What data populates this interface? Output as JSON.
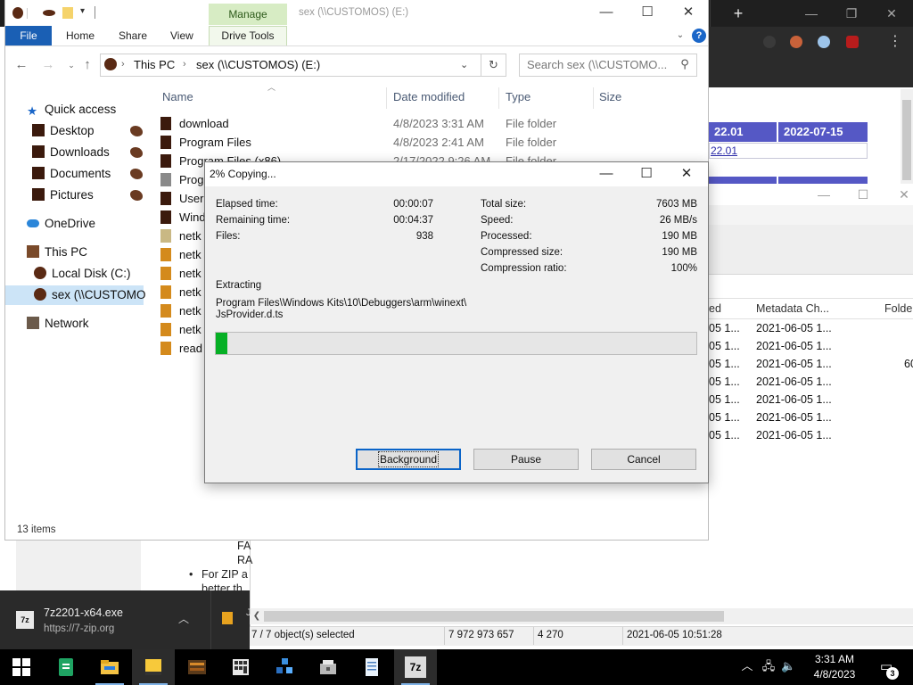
{
  "explorer": {
    "title": "sex (\\\\CUSTOMOS) (E:)",
    "manage_tab": "Manage",
    "ribbon": {
      "file": "File",
      "home": "Home",
      "share": "Share",
      "view": "View",
      "drive_tools": "Drive Tools"
    },
    "address": {
      "part1": "This PC",
      "part2": "sex (\\\\CUSTOMOS) (E:)"
    },
    "search_placeholder": "Search sex (\\\\CUSTOMO...",
    "nav": {
      "quick_access": "Quick access",
      "desktop": "Desktop",
      "downloads": "Downloads",
      "documents": "Documents",
      "pictures": "Pictures",
      "onedrive": "OneDrive",
      "this_pc": "This PC",
      "local_disk": "Local Disk (C:)",
      "sex_drive": "sex (\\\\CUSTOMO",
      "network": "Network"
    },
    "columns": {
      "name": "Name",
      "date": "Date modified",
      "type": "Type",
      "size": "Size"
    },
    "files": [
      {
        "name": "download",
        "date": "4/8/2023 3:31 AM",
        "type": "File folder"
      },
      {
        "name": "Program Files",
        "date": "4/8/2023 2:41 AM",
        "type": "File folder"
      },
      {
        "name": "Program Files (x86)",
        "date": "2/17/2022 9:26 AM",
        "type": "File folder"
      },
      {
        "name": "Prog"
      },
      {
        "name": "User"
      },
      {
        "name": "Wind"
      },
      {
        "name": "netk"
      },
      {
        "name": "netk"
      },
      {
        "name": "netk"
      },
      {
        "name": "netk"
      },
      {
        "name": "netk"
      },
      {
        "name": "netk"
      },
      {
        "name": "read"
      }
    ],
    "status": "13 items"
  },
  "dialog": {
    "title": "2% Copying...",
    "elapsed_label": "Elapsed time:",
    "elapsed_value": "00:00:07",
    "remaining_label": "Remaining time:",
    "remaining_value": "00:04:37",
    "files_label": "Files:",
    "files_value": "938",
    "total_label": "Total size:",
    "total_value": "7603 MB",
    "speed_label": "Speed:",
    "speed_value": "26 MB/s",
    "processed_label": "Processed:",
    "processed_value": "190 MB",
    "compressed_label": "Compressed size:",
    "compressed_value": "190 MB",
    "ratio_label": "Compression ratio:",
    "ratio_value": "100%",
    "operation": "Extracting",
    "path_line1": "Program Files\\Windows Kits\\10\\Debuggers\\arm\\winext\\",
    "path_line2": "JsProvider.d.ts",
    "progress": 0.025,
    "progress_color": "#06b025",
    "buttons": {
      "background": "Background",
      "pause": "Pause",
      "cancel": "Cancel"
    }
  },
  "sevenzip": {
    "columns": {
      "modified": "ed",
      "metadata": "Metadata Ch...",
      "folders": "Folde"
    },
    "rows": [
      {
        "modified": "05 1...",
        "metadata": "2021-06-05 1...",
        "folders": ""
      },
      {
        "modified": "05 1...",
        "metadata": "2021-06-05 1...",
        "folders": ""
      },
      {
        "modified": "05 1...",
        "metadata": "2021-06-05 1...",
        "folders": "60"
      },
      {
        "modified": "05 1...",
        "metadata": "2021-06-05 1...",
        "folders": ""
      },
      {
        "modified": "05 1...",
        "metadata": "2021-06-05 1...",
        "folders": ""
      },
      {
        "modified": "05 1...",
        "metadata": "2021-06-05 1...",
        "folders": ""
      },
      {
        "modified": "05 1...",
        "metadata": "2021-06-05 1...",
        "folders": ""
      }
    ],
    "status": {
      "selected": "7 / 7 object(s) selected",
      "size": "7 972 973 657",
      "count": "4 270",
      "date": "2021-06-05 10:51:28"
    }
  },
  "webpage": {
    "header_version": "22.01",
    "header_date": "2022-07-15",
    "link": "22.01",
    "text_fa": "FA",
    "text_ra": "RA",
    "bullet": "For ZIP a",
    "text_better": "better th"
  },
  "download": {
    "filename": "7z2201-x64.exe",
    "url": "https://7-zip.org",
    "icon_text": "7z",
    "item2_letter": "J"
  },
  "taskbar": {
    "time": "3:31 AM",
    "date": "4/8/2023",
    "notifications": "3",
    "sevenzip_label": "7z"
  }
}
